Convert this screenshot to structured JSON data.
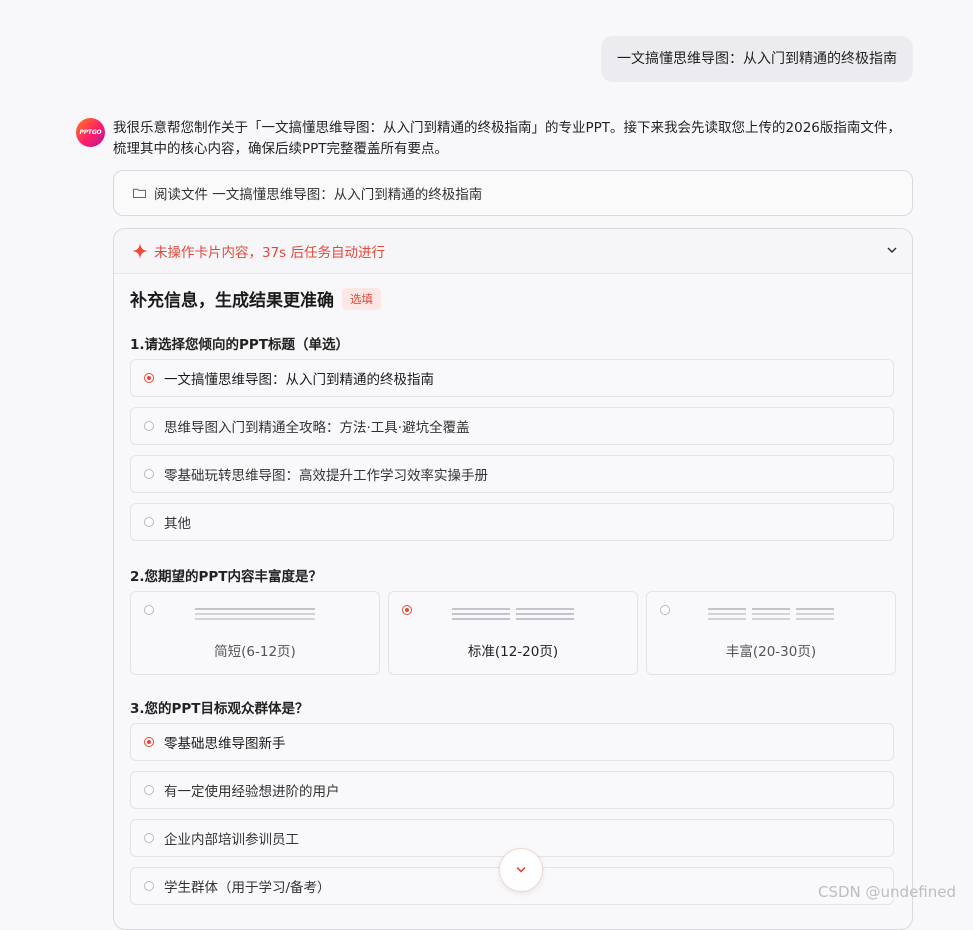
{
  "user_message": "一文搞懂思维导图：从入门到精通的终极指南",
  "avatar_text": "PPTGO",
  "assistant_intro": "我很乐意帮您制作关于「一文搞懂思维导图：从入门到精通的终极指南」的专业PPT。接下来我会先读取您上传的2026版指南文件，梳理其中的核心内容，确保后续PPT完整覆盖所有要点。",
  "file_read": {
    "icon": "folder-icon",
    "text": "阅读文件 一文搞懂思维导图：从入门到精通的终极指南"
  },
  "card": {
    "warning": "未操作卡片内容，37s 后任务自动进行",
    "title": "补充信息，生成结果更准确",
    "badge": "选填",
    "q1": {
      "label": "1.请选择您倾向的PPT标题（单选）",
      "options": [
        "一文搞懂思维导图：从入门到精通的终极指南",
        "思维导图入门到精通全攻略：方法·工具·避坑全覆盖",
        "零基础玩转思维导图：高效提升工作学习效率实操手册",
        "其他"
      ],
      "selected": 0
    },
    "q2": {
      "label": "2.您期望的PPT内容丰富度是？",
      "options": [
        "简短(6-12页)",
        "标准(12-20页)",
        "丰富(20-30页)"
      ],
      "selected": 1
    },
    "q3": {
      "label": "3.您的PPT目标观众群体是？",
      "options": [
        "零基础思维导图新手",
        "有一定使用经验想进阶的用户",
        "企业内部培训参训员工",
        "学生群体（用于学习/备考）"
      ],
      "selected": 0
    }
  },
  "colors": {
    "accent": "#e5483b",
    "badge_bg": "#fde7e4"
  },
  "watermark": "CSDN @undefined"
}
